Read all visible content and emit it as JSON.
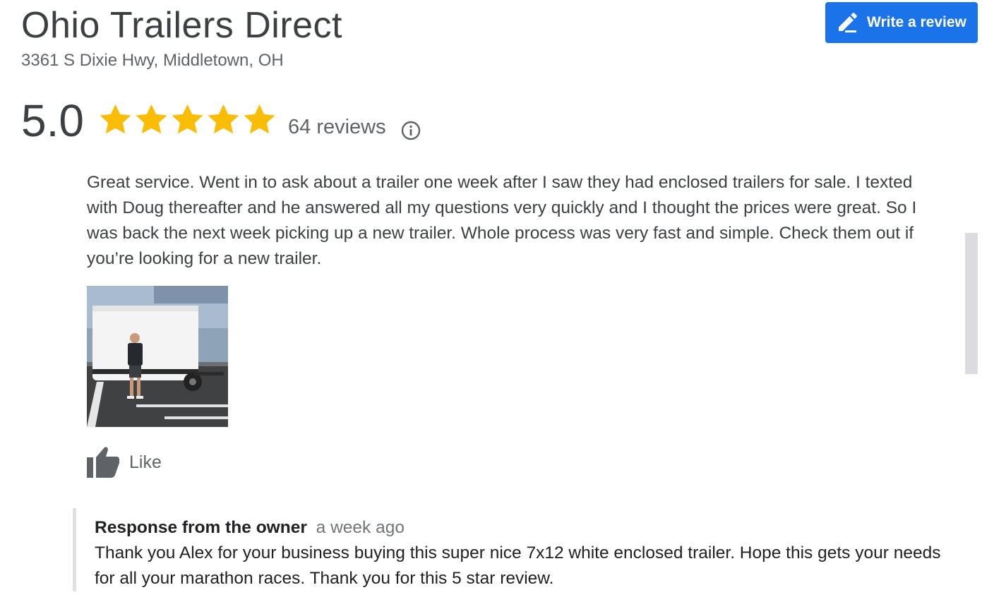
{
  "business": {
    "name": "Ohio Trailers Direct",
    "address": "3361 S Dixie Hwy, Middletown, OH"
  },
  "write_review": {
    "label": "Write a review",
    "icon": "pencil-icon",
    "color": "#1a73e8"
  },
  "rating": {
    "score": "5.0",
    "stars": 5,
    "star_color": "#fbbc04",
    "reviews_label": "64 reviews",
    "info_icon": "info-icon"
  },
  "review": {
    "text": "Great service. Went in to ask about a trailer one week after I saw they had enclosed trailers for sale. I texted with Doug thereafter and he answered all my questions very quickly and I thought the prices were great. So I was back the next week picking up a new trailer. Whole process was very fast and simple. Check them out if you’re looking for a new trailer.",
    "photo_icon": "review-photo",
    "like": {
      "label": "Like",
      "icon": "thumbs-up-icon"
    }
  },
  "owner_response": {
    "label": "Response from the owner",
    "time": "a week ago",
    "text": "Thank you Alex for your business buying this super nice 7x12 white enclosed trailer. Hope this gets your needs for all your marathon races. Thank you for this 5 star review."
  }
}
